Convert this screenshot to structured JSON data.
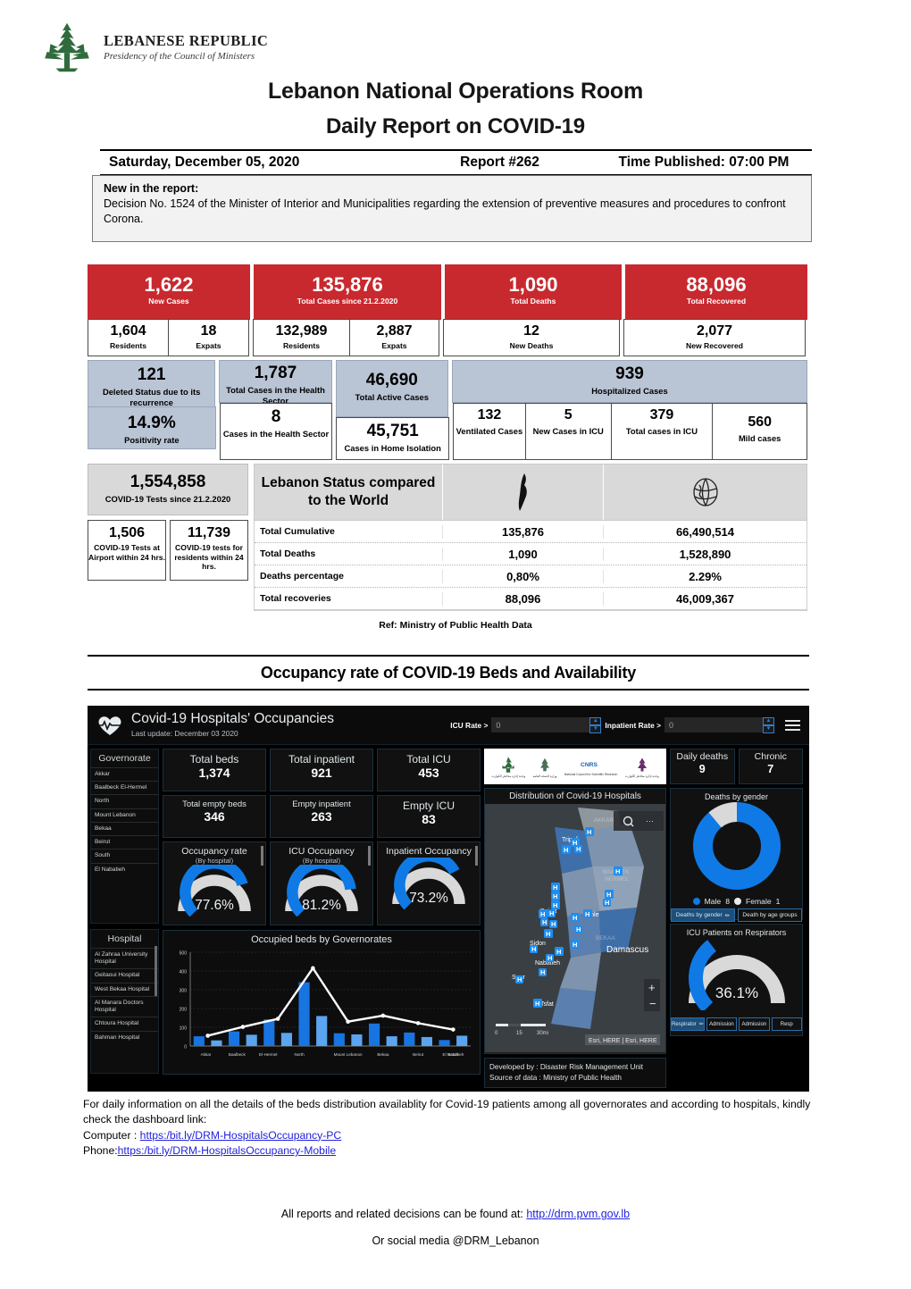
{
  "header": {
    "republic_line1": "LEBANESE REPUBLIC",
    "republic_line2": "Presidency of the Council of Ministers",
    "title1": "Lebanon National Operations Room",
    "title2": "Daily Report on COVID-19",
    "date": "Saturday, December 05, 2020",
    "report_no": "Report #262",
    "time_published": "Time Published: 07:00 PM"
  },
  "new_in_report": {
    "heading": "New in the report:",
    "body": "Decision No. 1524 of the Minister of Interior and Municipalities regarding the extension of preventive measures and procedures to confront Corona."
  },
  "stats": {
    "new_cases": {
      "value": "1,622",
      "label": "New Cases"
    },
    "total_cases": {
      "value": "135,876",
      "label": "Total Cases since 21.2.2020"
    },
    "total_deaths": {
      "value": "1,090",
      "label": "Total Deaths"
    },
    "total_recovered": {
      "value": "88,096",
      "label": "Total Recovered"
    },
    "new_residents": {
      "value": "1,604",
      "label": "Residents"
    },
    "new_expats": {
      "value": "18",
      "label": "Expats"
    },
    "total_residents": {
      "value": "132,989",
      "label": "Residents"
    },
    "total_expats": {
      "value": "2,887",
      "label": "Expats"
    },
    "new_deaths": {
      "value": "12",
      "label": "New Deaths"
    },
    "new_recovered": {
      "value": "2,077",
      "label": "New Recovered"
    },
    "deleted_status": {
      "value": "121",
      "label": "Deleted Status due to its recurrence"
    },
    "positivity_rate": {
      "value": "14.9%",
      "label": "Positivity rate"
    },
    "health_sector_total": {
      "value": "1,787",
      "label": "Total Cases in the Health Sector"
    },
    "health_sector_new": {
      "value": "8",
      "label": "Cases in the Health Sector"
    },
    "active_cases": {
      "value": "46,690",
      "label": "Total Active Cases"
    },
    "home_isolation": {
      "value": "45,751",
      "label": "Cases in Home Isolation"
    },
    "hospitalized": {
      "value": "939",
      "label": "Hospitalized Cases"
    },
    "ventilated": {
      "value": "132",
      "label": "Ventilated Cases"
    },
    "new_icu": {
      "value": "5",
      "label": "New Cases in ICU"
    },
    "total_icu": {
      "value": "379",
      "label": "Total cases in ICU"
    },
    "mild_cases": {
      "value": "560",
      "label": "Mild cases"
    },
    "tests_total": {
      "value": "1,554,858",
      "label": "COVID-19 Tests since 21.2.2020"
    },
    "tests_airport": {
      "value": "1,506",
      "label": "COVID-19 Tests at Airport within 24 hrs."
    },
    "tests_residents": {
      "value": "11,739",
      "label": "COVID-19 tests for residents within 24 hrs."
    }
  },
  "world_table": {
    "title": "Lebanon Status compared to the World",
    "col_lebanon_icon": "lebanon-map-icon",
    "col_world_icon": "globe-icon",
    "rows": [
      {
        "name": "Total Cumulative",
        "lebanon": "135,876",
        "world": "66,490,514"
      },
      {
        "name": "Total Deaths",
        "lebanon": "1,090",
        "world": "1,528,890"
      },
      {
        "name": "Deaths percentage",
        "lebanon": "0,80%",
        "world": "2.29%"
      },
      {
        "name": "Total recoveries",
        "lebanon": "88,096",
        "world": "46,009,367"
      }
    ]
  },
  "ref_line": "Ref: Ministry of Public Health Data",
  "section_title": "Occupancy rate of COVID-19 Beds and Availability",
  "dashboard": {
    "title": "Covid-19 Hospitals' Occupancies",
    "subtitle": "Last update: December 03 2020",
    "icu_rate_label": "ICU Rate >",
    "icu_rate_value": "0",
    "inpatient_rate_label": "Inpatient Rate >",
    "inpatient_rate_value": "0",
    "governorate_header": "Governorate",
    "governorates": [
      "Akkar",
      "Baalbeck El-Hermel",
      "North",
      "Mount Lebanon",
      "Bekaa",
      "Beirut",
      "South",
      "El Nabatieh"
    ],
    "hospital_header": "Hospital",
    "hospitals": [
      "Al Zahraa University Hospital",
      "Geitaoui Hospital",
      "West Bekaa Hospital",
      "Al Manara Doctors Hospital",
      "Chtoura Hospital",
      "Bahman Hospital"
    ],
    "kpis": [
      {
        "label": "Total beds",
        "value": "1,374"
      },
      {
        "label": "Total inpatient",
        "value": "921"
      },
      {
        "label": "Total ICU",
        "value": "453"
      },
      {
        "label": "Total empty beds",
        "value": "346"
      },
      {
        "label": "Empty inpatient",
        "value": "263"
      },
      {
        "label": "Empty ICU",
        "value": "83"
      }
    ],
    "gauges": [
      {
        "title": "Occupancy rate",
        "sub": "(By hospital)",
        "value": "77.6%",
        "pct": 77.6
      },
      {
        "title": "ICU Occupancy",
        "sub": "(By hospital)",
        "value": "81.2%",
        "pct": 81.2
      },
      {
        "title": "Inpatient Occupancy",
        "sub": "",
        "value": "73.2%",
        "pct": 73.2
      }
    ],
    "daily_deaths": {
      "label": "Daily deaths",
      "value": "9"
    },
    "chronic": {
      "label": "Chronic",
      "value": "7"
    },
    "deaths_by_gender_tabs": [
      "Deaths by gender",
      "Death by age groups"
    ],
    "respirator_tabs": [
      "Respirator",
      "Admission",
      "Admission",
      "Resp"
    ],
    "map_title": "Distribution of Covid-19 Hospitals",
    "map_labels": [
      "Tripoli",
      "Beirut",
      "Zahle",
      "Sidon",
      "Nabatieh",
      "Sour",
      "Tsfat",
      "Damascus",
      "AKKAR",
      "BAALBEK HERMEL",
      "BEKAA"
    ],
    "map_attribution": "Esri, HERE | Esri, HERE",
    "map_scale": [
      "0",
      "15",
      "30mi"
    ],
    "credits_line1": "Developed by :   Disaster Risk Management Unit",
    "credits_line2": "Source of data :  Ministry of Public Health",
    "respirator_title": "ICU Patients on Respirators",
    "respirator_value": "36.1%",
    "colors": {
      "accent_blue": "#0f7ae5",
      "light_grey": "#d9d9d9",
      "panel": "#111111"
    }
  },
  "chart_data": [
    {
      "type": "bar",
      "title": "Occupied beds by Governorates",
      "categories": [
        "Akkar",
        "Baalbeck",
        "El-Hermel",
        "North",
        "Mount Lebanon",
        "Bekaa",
        "Beirut",
        "South",
        "El Nabatieh"
      ],
      "bar_labels": [
        "Akkar",
        "Baalbeck",
        "El-Hermel",
        "North",
        "",
        "Mount Lebanon",
        "",
        "Bekaa",
        "",
        "Beirut",
        "",
        "South",
        "",
        "El Nabatieh",
        ""
      ],
      "series": [
        {
          "name": "Occupied beds",
          "values": [
            52,
            30,
            78,
            60,
            142,
            70,
            340,
            160,
            68,
            62,
            120,
            52,
            72,
            48,
            32,
            55
          ]
        },
        {
          "name": "Total line",
          "values": [
            55,
            102,
            145,
            415,
            130,
            162,
            122,
            88
          ]
        }
      ],
      "ylabel": "",
      "xlabel": "",
      "ylim": [
        0,
        500
      ],
      "yticks": [
        "0",
        "100",
        "200",
        "300",
        "400",
        "500"
      ],
      "grid": true,
      "legend": "none"
    },
    {
      "type": "pie",
      "title": "Deaths by gender",
      "categories": [
        "Male",
        "Female"
      ],
      "values": [
        8,
        1
      ],
      "colors": [
        "#0f7ae5",
        "#d9d9d9"
      ],
      "legend": "bottom"
    },
    {
      "type": "gauge",
      "title": "Occupancy rate",
      "subtitle": "(By hospital)",
      "value": 77.6,
      "display": "77.6%",
      "range": [
        0,
        100
      ]
    },
    {
      "type": "gauge",
      "title": "ICU Occupancy",
      "subtitle": "(By hospital)",
      "value": 81.2,
      "display": "81.2%",
      "range": [
        0,
        100
      ]
    },
    {
      "type": "gauge",
      "title": "Inpatient Occupancy",
      "subtitle": "",
      "value": 73.2,
      "display": "73.2%",
      "range": [
        0,
        100
      ]
    },
    {
      "type": "gauge",
      "title": "ICU Patients on Respirators",
      "value": 36.1,
      "display": "36.1%",
      "range": [
        0,
        100
      ]
    }
  ],
  "footer": {
    "line1": "For daily information on all the details of the beds distribution availablity for Covid-19 patients among all governorates and according to hospitals, kindly check the dashboard link:",
    "computer_label": "Computer : ",
    "computer_link": "https:/bit.ly/DRM-HospitalsOccupancy-PC",
    "phone_label": "Phone:",
    "phone_link": "https:/bit.ly/DRM-HospitalsOccupancy-Mobile",
    "reports_text": "All reports and related decisions can be found at: ",
    "reports_link": "http://drm.pvm.gov.lb",
    "social": "Or social media @DRM_Lebanon"
  }
}
